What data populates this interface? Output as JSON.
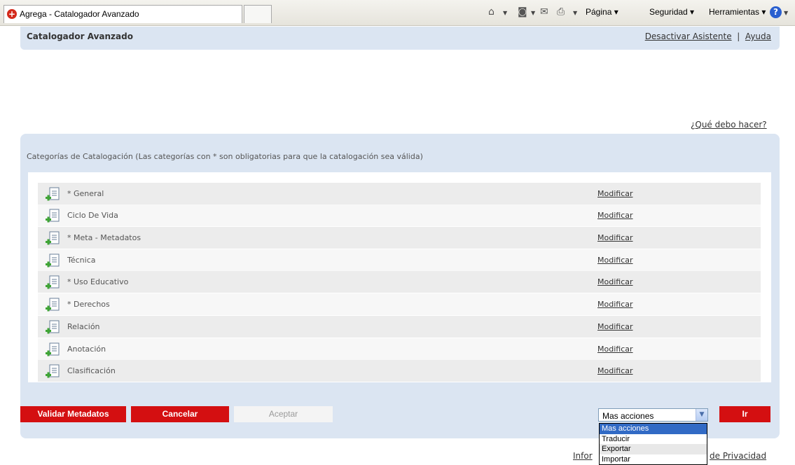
{
  "browser": {
    "tab_title": "Agrega - Catalogador Avanzado",
    "cmd_page": "Página",
    "cmd_security": "Seguridad",
    "cmd_tools": "Herramientas"
  },
  "header": {
    "title": "Catalogador Avanzado",
    "deactivate_link": "Desactivar Asistente",
    "separator": "|",
    "help_link": "Ayuda"
  },
  "help_question": "¿Qué debo hacer?",
  "panel": {
    "description": "Categorías de Catalogación (Las categorías con * son obligatorias para que la catalogación sea válida)"
  },
  "categories": [
    {
      "label": "* General",
      "action": "Modificar"
    },
    {
      "label": "Ciclo De Vida",
      "action": "Modificar"
    },
    {
      "label": "* Meta - Metadatos",
      "action": "Modificar"
    },
    {
      "label": "Técnica",
      "action": "Modificar"
    },
    {
      "label": "* Uso Educativo",
      "action": "Modificar"
    },
    {
      "label": "* Derechos",
      "action": "Modificar"
    },
    {
      "label": "Relación",
      "action": "Modificar"
    },
    {
      "label": "Anotación",
      "action": "Modificar"
    },
    {
      "label": "Clasificación",
      "action": "Modificar"
    }
  ],
  "buttons": {
    "validate": "Validar Metadatos",
    "cancel": "Cancelar",
    "accept": "Aceptar",
    "go": "Ir"
  },
  "actions_select": {
    "value": "Mas acciones",
    "options": [
      "Mas acciones",
      "Traducir",
      "Exportar",
      "Importar"
    ]
  },
  "footer": {
    "left": "Infor",
    "right": "de Privacidad"
  },
  "colors": {
    "accent_red": "#d40f11",
    "panel_blue": "#dbe5f2",
    "selected_option": "#316ac5"
  }
}
